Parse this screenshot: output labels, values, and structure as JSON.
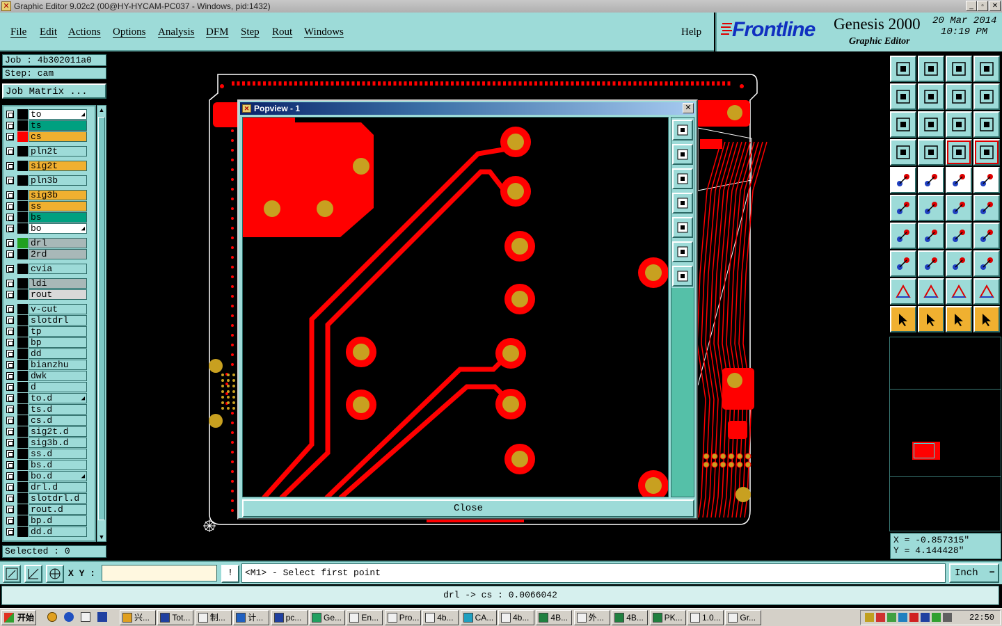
{
  "window": {
    "title": "Graphic Editor 9.02c2 (00@HY-HYCAM-PC037 - Windows, pid:1432)"
  },
  "menu": {
    "items": [
      "File",
      "Edit",
      "Actions",
      "Options",
      "Analysis",
      "DFM",
      "Step",
      "Rout",
      "Windows"
    ],
    "help": "Help"
  },
  "brand": {
    "logo": "Frontline",
    "product": "Genesis 2000",
    "subtitle": "Graphic Editor",
    "date": "20 Mar 2014",
    "time": "10:19 PM"
  },
  "job": {
    "job_label": "Job : 4b302011a0",
    "step_label": "Step: cam",
    "matrix_button": "Job Matrix ..."
  },
  "layers": [
    {
      "name": "to",
      "color": "#ffffff",
      "mark": "#000000",
      "arrow": true
    },
    {
      "name": "ts",
      "color": "#00a080",
      "mark": "#000000"
    },
    {
      "name": "cs",
      "color": "#f0b030",
      "mark": "#ff0000"
    },
    {
      "name": "pln2t",
      "color": "#9ddbd8",
      "mark": "#000000"
    },
    {
      "name": "sig2t",
      "color": "#f0b030",
      "mark": "#000000"
    },
    {
      "name": "pln3b",
      "color": "#9ddbd8",
      "mark": "#000000"
    },
    {
      "name": "sig3b",
      "color": "#f0b030",
      "mark": "#000000"
    },
    {
      "name": "ss",
      "color": "#f0b030",
      "mark": "#000000"
    },
    {
      "name": "bs",
      "color": "#00a080",
      "mark": "#000000"
    },
    {
      "name": "bo",
      "color": "#ffffff",
      "mark": "#000000",
      "arrow": true
    },
    {
      "name": "drl",
      "color": "#a8b8b8",
      "mark": "#20a020"
    },
    {
      "name": "2rd",
      "color": "#a8b8b8",
      "mark": "#000000"
    },
    {
      "name": "cvia",
      "color": "#9ddbd8",
      "mark": "#000000"
    },
    {
      "name": "ldi",
      "color": "#a8b8b8",
      "mark": "#000000"
    },
    {
      "name": "rout",
      "color": "#d8d8d8",
      "mark": "#000000"
    },
    {
      "name": "v-cut",
      "color": "#9ddbd8",
      "mark": "#000000"
    },
    {
      "name": "slotdrl",
      "color": "#9ddbd8",
      "mark": "#000000"
    },
    {
      "name": "tp",
      "color": "#9ddbd8",
      "mark": "#000000"
    },
    {
      "name": "bp",
      "color": "#9ddbd8",
      "mark": "#000000"
    },
    {
      "name": "dd",
      "color": "#9ddbd8",
      "mark": "#000000"
    },
    {
      "name": "bianzhu",
      "color": "#9ddbd8",
      "mark": "#000000"
    },
    {
      "name": "dwk",
      "color": "#9ddbd8",
      "mark": "#000000"
    },
    {
      "name": "d",
      "color": "#9ddbd8",
      "mark": "#000000"
    },
    {
      "name": "to.d",
      "color": "#9ddbd8",
      "mark": "#000000",
      "arrow": true
    },
    {
      "name": "ts.d",
      "color": "#9ddbd8",
      "mark": "#000000"
    },
    {
      "name": "cs.d",
      "color": "#9ddbd8",
      "mark": "#000000"
    },
    {
      "name": "sig2t.d",
      "color": "#9ddbd8",
      "mark": "#000000"
    },
    {
      "name": "sig3b.d",
      "color": "#9ddbd8",
      "mark": "#000000"
    },
    {
      "name": "ss.d",
      "color": "#9ddbd8",
      "mark": "#000000"
    },
    {
      "name": "bs.d",
      "color": "#9ddbd8",
      "mark": "#000000"
    },
    {
      "name": "bo.d",
      "color": "#9ddbd8",
      "mark": "#000000",
      "arrow": true
    },
    {
      "name": "drl.d",
      "color": "#9ddbd8",
      "mark": "#000000"
    },
    {
      "name": "slotdrl.d",
      "color": "#9ddbd8",
      "mark": "#000000"
    },
    {
      "name": "rout.d",
      "color": "#9ddbd8",
      "mark": "#000000"
    },
    {
      "name": "bp.d",
      "color": "#9ddbd8",
      "mark": "#000000"
    },
    {
      "name": "dd.d",
      "color": "#9ddbd8",
      "mark": "#000000"
    }
  ],
  "selected": "Selected : 0",
  "popup": {
    "title": "Popview - 1",
    "close_label": "Close"
  },
  "coords": {
    "x": "X = -0.857315\"",
    "y": "Y = 4.144428\""
  },
  "bottom": {
    "xy_label": "X Y :",
    "xy_value": "",
    "prompt": "<M1> - Select first point",
    "units": "Inch"
  },
  "status": "drl -> cs : 0.0066042",
  "taskbar": {
    "start": "开始",
    "tasks": [
      "兴...",
      "Tot...",
      "制...",
      "计...",
      "pc...",
      "Ge...",
      "En...",
      "Pro...",
      "4b...",
      "CA...",
      "4b...",
      "4B...",
      "外...",
      "4B...",
      "PK...",
      "1.0...",
      "Gr..."
    ],
    "clock": "22:50"
  },
  "colors": {
    "panel": "#9ddbd8",
    "copper": "#ff0000",
    "pad": "#c8a020"
  }
}
